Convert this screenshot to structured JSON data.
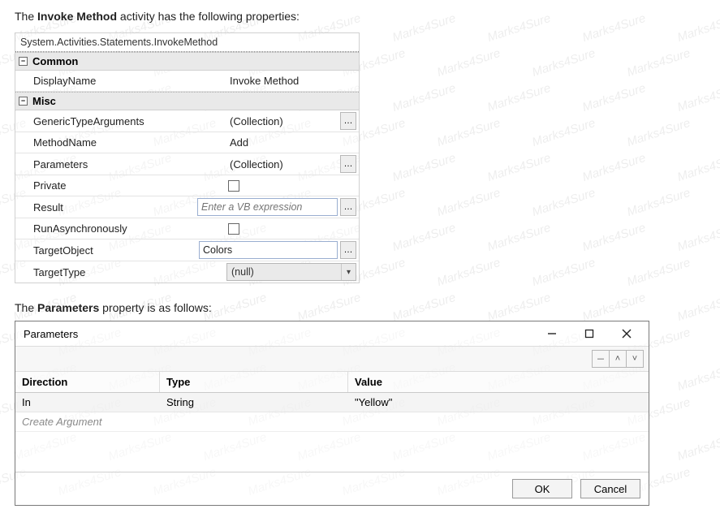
{
  "watermark_text": "Marks4Sure",
  "intro": {
    "pre": "The ",
    "bold": "Invoke Method",
    "post": " activity has the following properties:"
  },
  "propgrid": {
    "header": "System.Activities.Statements.InvokeMethod",
    "categories": [
      {
        "name": "Common",
        "collapse_glyph": "−",
        "rows": [
          {
            "name": "DisplayName",
            "kind": "text",
            "value": "Invoke Method"
          }
        ]
      },
      {
        "name": "Misc",
        "collapse_glyph": "−",
        "rows": [
          {
            "name": "GenericTypeArguments",
            "kind": "collection",
            "value": "(Collection)"
          },
          {
            "name": "MethodName",
            "kind": "text",
            "value": "Add"
          },
          {
            "name": "Parameters",
            "kind": "collection",
            "value": "(Collection)"
          },
          {
            "name": "Private",
            "kind": "checkbox",
            "checked": false
          },
          {
            "name": "Result",
            "kind": "vb",
            "placeholder": "Enter a VB expression"
          },
          {
            "name": "RunAsynchronously",
            "kind": "checkbox",
            "checked": false
          },
          {
            "name": "TargetObject",
            "kind": "object",
            "value": "Colors"
          },
          {
            "name": "TargetType",
            "kind": "combo",
            "value": "(null)"
          }
        ]
      }
    ]
  },
  "mid": {
    "pre": "The ",
    "bold": "Parameters",
    "post": " property is as follows:"
  },
  "dialog": {
    "title": "Parameters",
    "toolbar": {
      "del": "－",
      "up": "˄",
      "down": "˅"
    },
    "columns": {
      "direction": "Direction",
      "type": "Type",
      "value": "Value"
    },
    "rows": [
      {
        "direction": "In",
        "type": "String",
        "value": "\"Yellow\""
      }
    ],
    "create_text": "Create Argument",
    "ok": "OK",
    "cancel": "Cancel"
  }
}
